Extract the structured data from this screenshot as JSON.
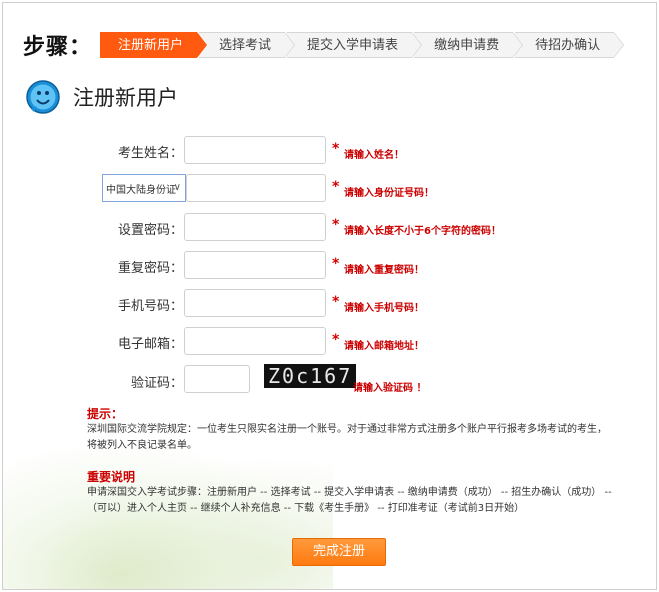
{
  "steps": {
    "label": "步骤：",
    "items": [
      {
        "label": "注册新用户",
        "active": true
      },
      {
        "label": "选择考试",
        "active": false
      },
      {
        "label": "提交入学申请表",
        "active": false
      },
      {
        "label": "缴纳申请费",
        "active": false
      },
      {
        "label": "待招办确认",
        "active": false
      }
    ]
  },
  "page_title": "注册新用户",
  "form": {
    "name": {
      "label": "考生姓名：",
      "required": "*",
      "hint": "请输入姓名！"
    },
    "id": {
      "select_value": "中国大陆身份证",
      "required": "*",
      "hint": "请输入身份证号码！"
    },
    "password": {
      "label": "设置密码：",
      "required": "*",
      "hint": "请输入长度不小于6个字符的密码！"
    },
    "confirm": {
      "label": "重复密码：",
      "required": "*",
      "hint": "请输入重复密码！"
    },
    "phone": {
      "label": "手机号码：",
      "required": "*",
      "hint": "请输入手机号码！"
    },
    "email": {
      "label": "电子邮箱：",
      "required": "*",
      "hint": "请输入邮箱地址！"
    },
    "captcha": {
      "label": "验证码：",
      "image_text": "Z0c167",
      "hint": "请输入验证码 ！"
    }
  },
  "tips": {
    "title": "提示：",
    "text": "深圳国际交流学院规定：一位考生只限实名注册一个账号。对于通过非常方式注册多个账户平行报考多场考试的考生，将被列入不良记录名单。"
  },
  "notes": {
    "title": "重要说明",
    "text": "申请深国交入学考试步骤：注册新用户 -- 选择考试 -- 提交入学申请表 -- 缴纳申请费（成功） -- 招生办确认（成功） --（可以）进入个人主页 -- 继续个人补充信息 -- 下载《考生手册》 -- 打印准考证（考试前3日开始）"
  },
  "submit_label": "完成注册",
  "colors": {
    "accent": "#ff5a0f",
    "error": "#cc0000",
    "button": "#ff7a10"
  }
}
